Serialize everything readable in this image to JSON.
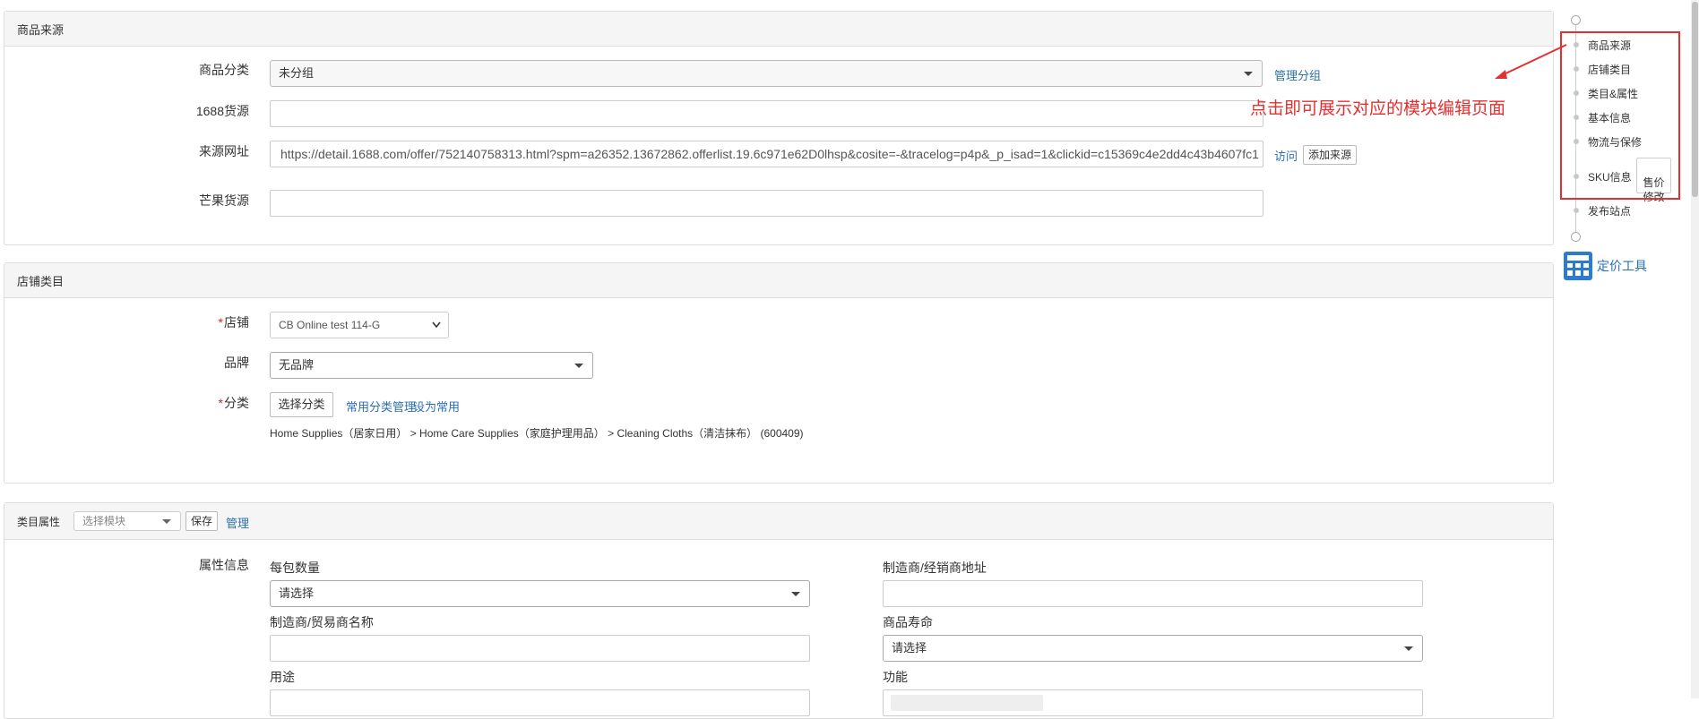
{
  "source_panel": {
    "title": "商品来源",
    "category_label": "商品分类",
    "category_value": "未分组",
    "manage_group_link": "管理分组",
    "source1688_label": "1688货源",
    "source1688_value": "",
    "url_label": "来源网址",
    "url_value": "https://detail.1688.com/offer/752140758313.html?spm=a26352.13672862.offerlist.19.6c971e62D0lhsp&cosite=-&tracelog=p4p&_p_isad=1&clickid=c15369c4e2dd4c43b4607fc1",
    "visit_link": "访问",
    "add_source_button": "添加来源",
    "mango_label": "芒果货源",
    "mango_value": ""
  },
  "store_panel": {
    "title": "店铺类目",
    "store_label": "店铺",
    "store_value": "CB Online test 114-G",
    "brand_label": "品牌",
    "brand_value": "无品牌",
    "category_label": "分类",
    "choose_category_button": "选择分类",
    "common_manage_link": "常用分类管理",
    "set_common_link": "设为常用",
    "category_path": "Home Supplies（居家日用） > Home Care Supplies（家庭护理用品） > Cleaning Cloths（清洁抹布） (600409)"
  },
  "attr_panel": {
    "title": "类目属性",
    "module_placeholder": "选择模块",
    "save_button": "保存",
    "manage_link": "管理",
    "info_label": "属性信息",
    "fields": {
      "per_pack": {
        "label": "每包数量",
        "value": "请选择"
      },
      "mfr_address": {
        "label": "制造商/经销商地址",
        "value": ""
      },
      "mfr_name": {
        "label": "制造商/贸易商名称",
        "value": ""
      },
      "life": {
        "label": "商品寿命",
        "value": "请选择"
      },
      "usage": {
        "label": "用途"
      },
      "function": {
        "label": "功能"
      }
    }
  },
  "side_nav": {
    "items": [
      "商品来源",
      "店铺类目",
      "类目&属性",
      "基本信息",
      "物流与保修",
      "SKU信息",
      "发布站点"
    ],
    "sku_tag": "售价\n修改",
    "pricing_tool": "定价工具",
    "annotation": "点击即可展示对应的模块编辑页面"
  },
  "colors": {
    "link": "#2a6fb6",
    "annotation": "#e53030",
    "pricing_icon": "#2b7bd1"
  }
}
